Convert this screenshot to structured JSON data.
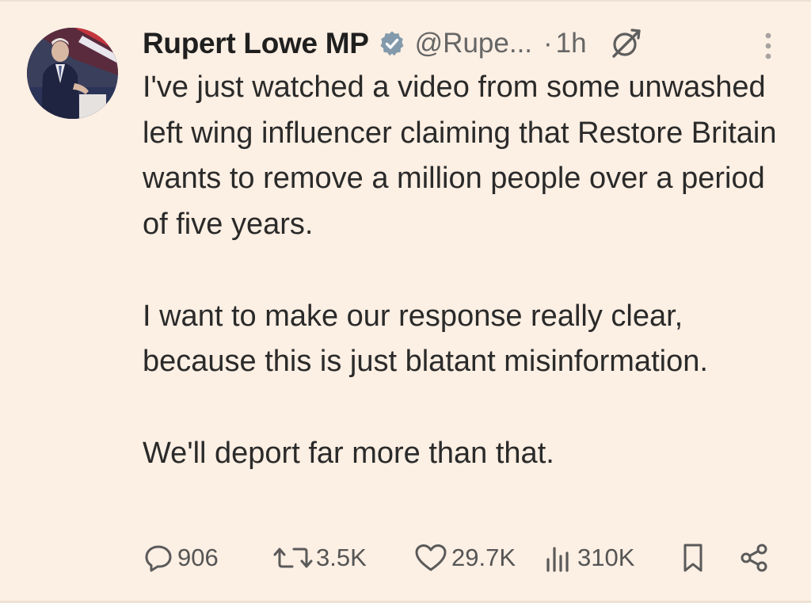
{
  "author": {
    "name": "Rupert Lowe MP",
    "handle": "@Rupe...",
    "separator": "·",
    "time": "1h",
    "verified": true,
    "avatar": "avatar-photo"
  },
  "tweet": {
    "paragraphs": [
      "I've just watched a video from some unwashed left wing influencer claiming that Restore Britain wants to remove a million people over a period of five years.",
      "I want to make our response really clear, because this is just blatant misinformation.",
      "We'll deport far more than that."
    ]
  },
  "actions": {
    "reply_count": "906",
    "repost_count": "3.5K",
    "like_count": "29.7K",
    "views_count": "310K"
  },
  "icons": {
    "verified": "verified-badge-icon",
    "grok": "grok-icon",
    "more": "more-vertical-icon",
    "reply": "reply-icon",
    "repost": "repost-icon",
    "like": "heart-icon",
    "views": "views-chart-icon",
    "bookmark": "bookmark-icon",
    "share": "share-icon"
  },
  "colors": {
    "background": "#fcefe3",
    "text": "#2a2a2a",
    "muted": "#666666",
    "verified_badge": "#829aab"
  }
}
